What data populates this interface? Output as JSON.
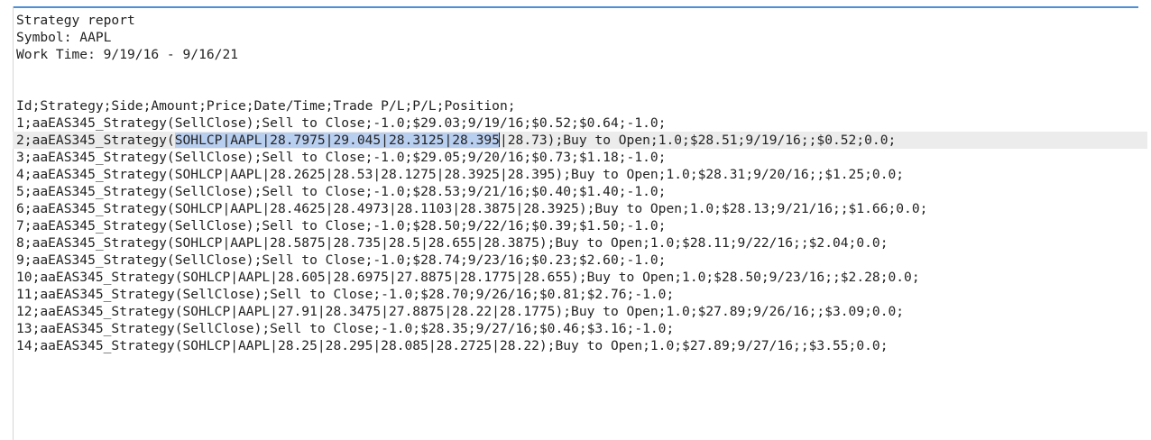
{
  "header": {
    "title": "Strategy report",
    "symbol": "Symbol: AAPL",
    "work_time": "Work Time: 9/19/16 - 9/16/21"
  },
  "csv_header": "Id;Strategy;Side;Amount;Price;Date/Time;Trade P/L;P/L;Position;",
  "rows": [
    "1;aaEAS345_Strategy(SellClose);Sell to Close;-1.0;$29.03;9/19/16;$0.52;$0.64;-1.0;",
    {
      "before": "2;aaEAS345_Strategy(",
      "selected": "SOHLCP|AAPL|28.7975|29.045|28.3125|28.395",
      "after": "|28.73);Buy to Open;1.0;$28.51;9/19/16;;$0.52;0.0;"
    },
    "3;aaEAS345_Strategy(SellClose);Sell to Close;-1.0;$29.05;9/20/16;$0.73;$1.18;-1.0;",
    "4;aaEAS345_Strategy(SOHLCP|AAPL|28.2625|28.53|28.1275|28.3925|28.395);Buy to Open;1.0;$28.31;9/20/16;;$1.25;0.0;",
    "5;aaEAS345_Strategy(SellClose);Sell to Close;-1.0;$28.53;9/21/16;$0.40;$1.40;-1.0;",
    "6;aaEAS345_Strategy(SOHLCP|AAPL|28.4625|28.4973|28.1103|28.3875|28.3925);Buy to Open;1.0;$28.13;9/21/16;;$1.66;0.0;",
    "7;aaEAS345_Strategy(SellClose);Sell to Close;-1.0;$28.50;9/22/16;$0.39;$1.50;-1.0;",
    "8;aaEAS345_Strategy(SOHLCP|AAPL|28.5875|28.735|28.5|28.655|28.3875);Buy to Open;1.0;$28.11;9/22/16;;$2.04;0.0;",
    "9;aaEAS345_Strategy(SellClose);Sell to Close;-1.0;$28.74;9/23/16;$0.23;$2.60;-1.0;",
    "10;aaEAS345_Strategy(SOHLCP|AAPL|28.605|28.6975|27.8875|28.1775|28.655);Buy to Open;1.0;$28.50;9/23/16;;$2.28;0.0;",
    "11;aaEAS345_Strategy(SellClose);Sell to Close;-1.0;$28.70;9/26/16;$0.81;$2.76;-1.0;",
    "12;aaEAS345_Strategy(SOHLCP|AAPL|27.91|28.3475|27.8875|28.22|28.1775);Buy to Open;1.0;$27.89;9/26/16;;$3.09;0.0;",
    "13;aaEAS345_Strategy(SellClose);Sell to Close;-1.0;$28.35;9/27/16;$0.46;$3.16;-1.0;",
    "14;aaEAS345_Strategy(SOHLCP|AAPL|28.25|28.295|28.085|28.2725|28.22);Buy to Open;1.0;$27.89;9/27/16;;$3.55;0.0;"
  ],
  "colors": {
    "text": "#222222",
    "selection": "#b9cff0",
    "current_line": "#ececec",
    "accent_border": "#4f8fd8"
  }
}
